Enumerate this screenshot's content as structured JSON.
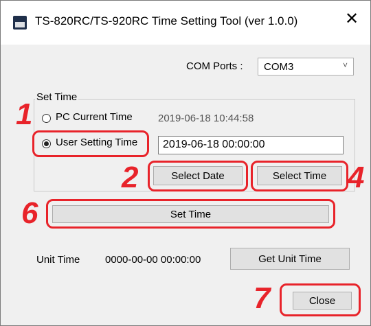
{
  "window": {
    "title": "TS-820RC/TS-920RC Time Setting Tool (ver 1.0.0)",
    "close_glyph": "✕"
  },
  "com": {
    "label": "COM Ports :",
    "selected": "COM3",
    "arrow_glyph": "˅"
  },
  "set_time_group": {
    "title": "Set Time",
    "pc_current_label": "PC Current Time",
    "pc_current_value": "2019-06-18 10:44:58",
    "user_setting_label": "User Setting Time",
    "user_setting_value": "2019-06-18 00:00:00",
    "selected_option": "user_setting"
  },
  "buttons": {
    "select_date": "Select Date",
    "select_time": "Select Time",
    "set_time": "Set Time",
    "get_unit_time": "Get Unit Time",
    "close": "Close"
  },
  "unit_time": {
    "label": "Unit Time",
    "value": "0000-00-00 00:00:00"
  },
  "annotations": {
    "step1": "1",
    "step2": "2",
    "step4": "4",
    "step6": "6",
    "step7": "7",
    "highlight_color": "#e8232a"
  }
}
